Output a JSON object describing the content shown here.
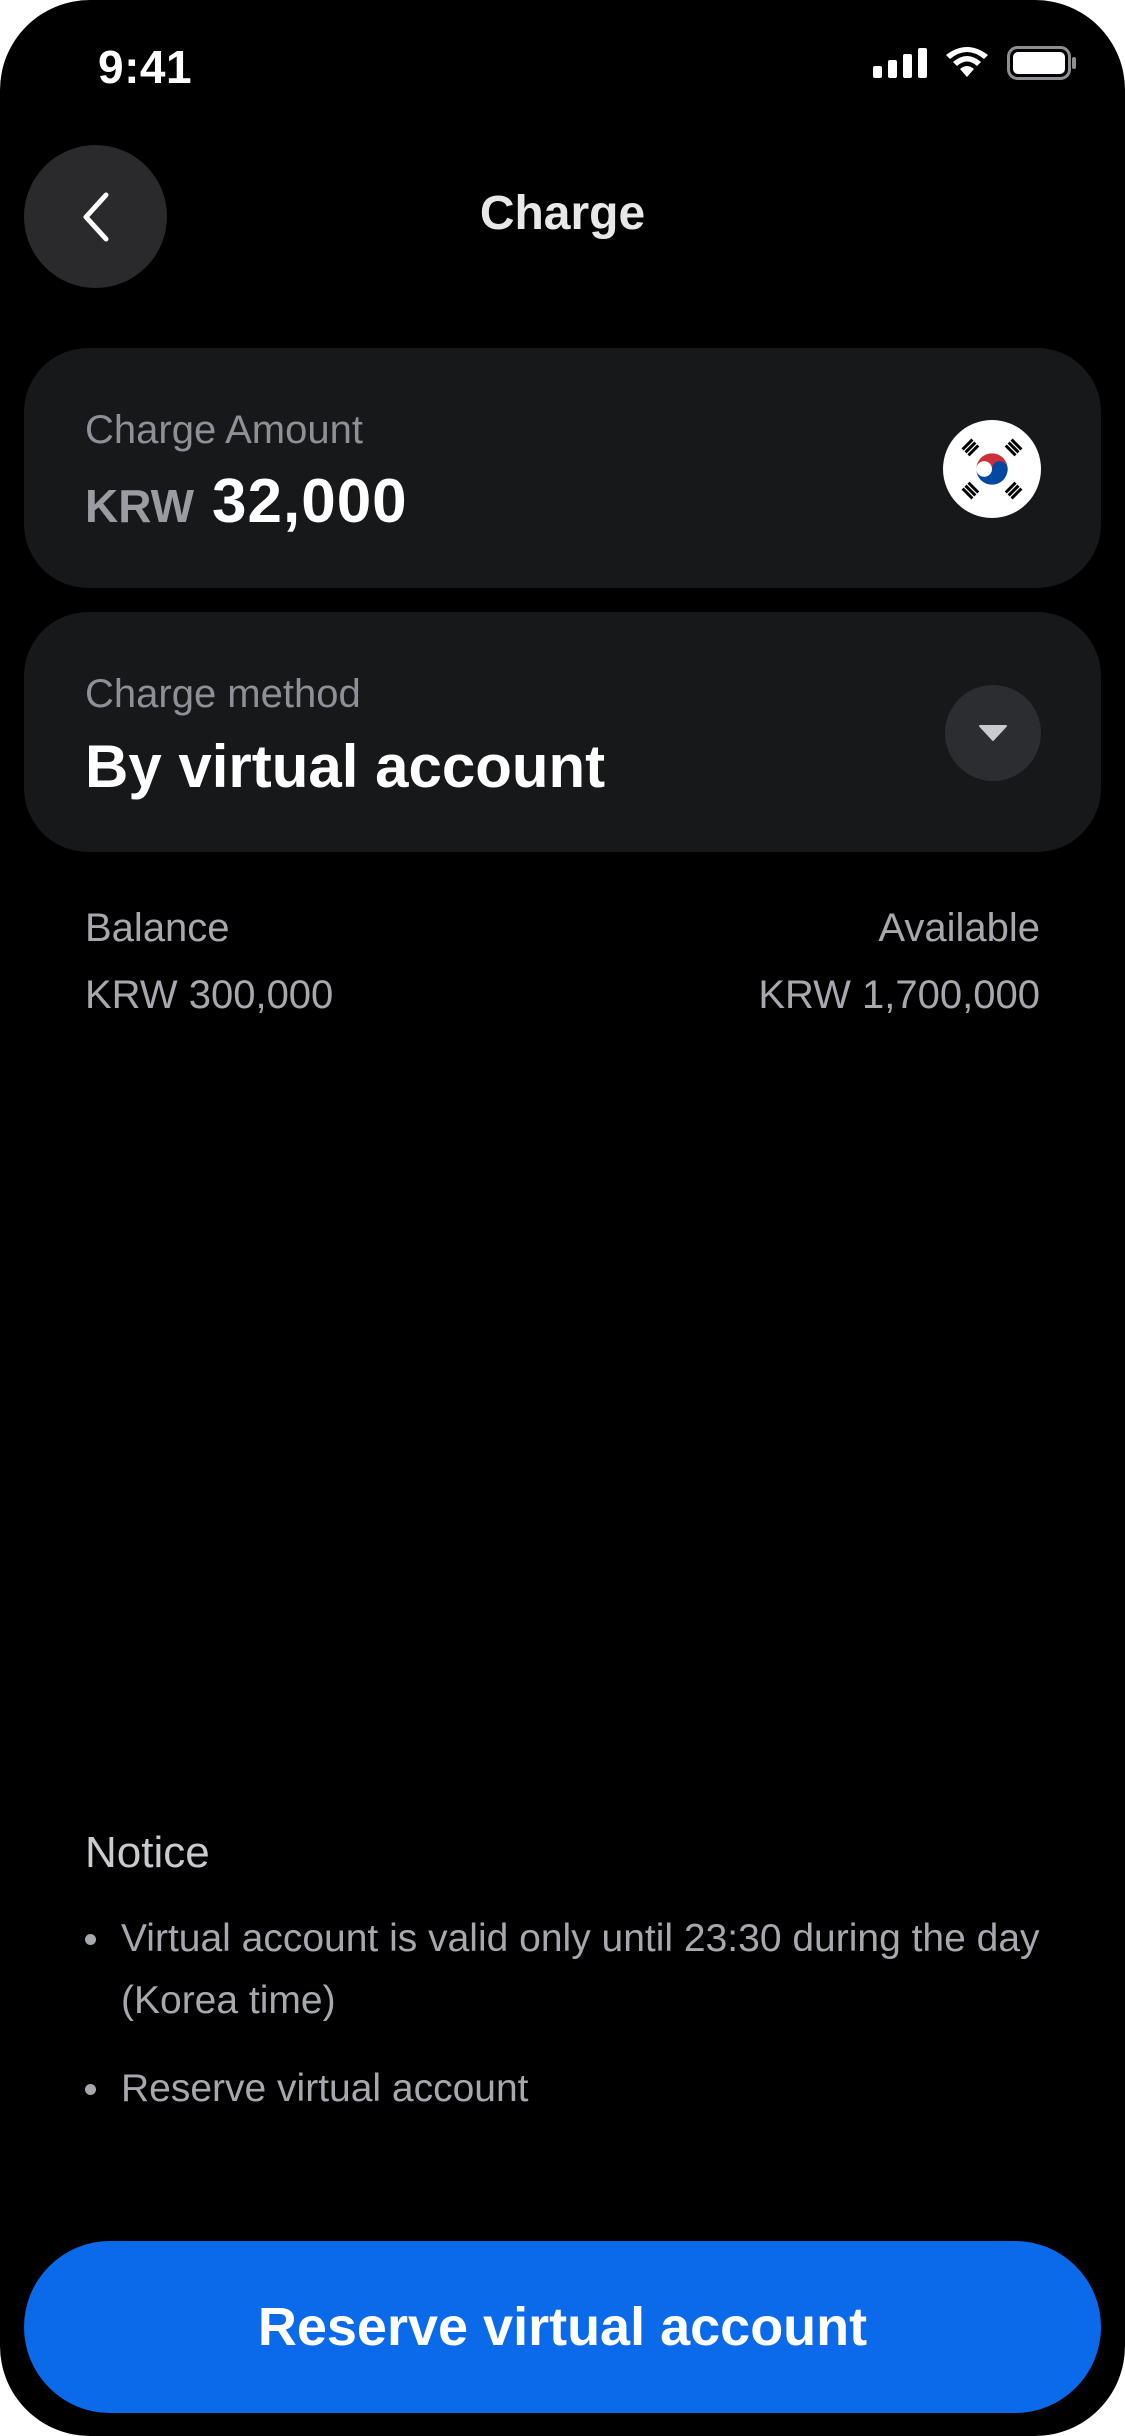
{
  "status_bar": {
    "time": "9:41",
    "icons": [
      "cellular-signal-icon",
      "wifi-icon",
      "battery-icon"
    ]
  },
  "header": {
    "title": "Charge",
    "back_icon": "chevron-left-icon"
  },
  "amount_card": {
    "label": "Charge Amount",
    "currency": "KRW",
    "value": "32,000",
    "flag_icon": "south-korea-flag-icon"
  },
  "method_card": {
    "label": "Charge method",
    "value": "By virtual account",
    "dropdown_icon": "caret-down-icon"
  },
  "balance": {
    "balance_label": "Balance",
    "balance_value": "KRW 300,000",
    "available_label": "Available",
    "available_value": "KRW 1,700,000"
  },
  "notice": {
    "title": "Notice",
    "items": [
      "Virtual account is valid only until 23:30 during the day (Korea time)",
      "Reserve virtual account"
    ]
  },
  "cta": {
    "label": "Reserve virtual account"
  },
  "colors": {
    "background": "#000000",
    "card": "#17181a",
    "accent": "#0b6aea",
    "muted_text": "#a6a8ad"
  }
}
